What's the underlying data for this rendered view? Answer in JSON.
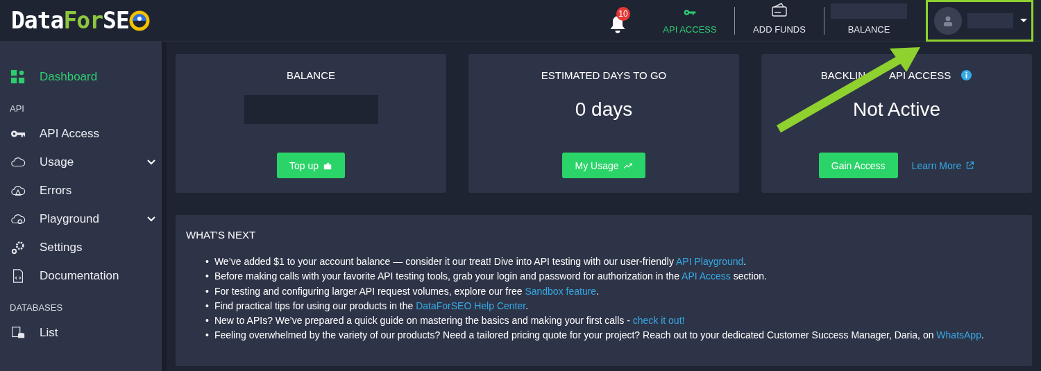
{
  "header": {
    "logo": {
      "parts": [
        "Data",
        "For",
        "SE"
      ]
    },
    "notifications": {
      "count": "10"
    },
    "nav": [
      {
        "kind": "key",
        "label": "API ACCESS",
        "selected": true
      },
      {
        "kind": "card",
        "label": "ADD FUNDS",
        "selected": false
      },
      {
        "kind": "balance",
        "label": "BALANCE",
        "selected": false
      }
    ],
    "user": {
      "kind": "avatar"
    }
  },
  "sidebar": {
    "items": [
      {
        "kind": "item",
        "label": "Dashboard",
        "selected": true,
        "expandable": false
      },
      {
        "kind": "section",
        "label": "API"
      },
      {
        "kind": "item",
        "label": "API Access",
        "selected": false,
        "expandable": false
      },
      {
        "kind": "item",
        "label": "Usage",
        "selected": false,
        "expandable": true
      },
      {
        "kind": "item",
        "label": "Errors",
        "selected": false,
        "expandable": false
      },
      {
        "kind": "item",
        "label": "Playground",
        "selected": false,
        "expandable": true
      },
      {
        "kind": "item",
        "label": "Settings",
        "selected": false,
        "expandable": false
      },
      {
        "kind": "item",
        "label": "Documentation",
        "selected": false,
        "expandable": false
      },
      {
        "kind": "section",
        "label": "DATABASES"
      },
      {
        "kind": "item",
        "label": "List",
        "selected": false,
        "expandable": false
      }
    ]
  },
  "cards": [
    {
      "title": [
        "BALANCE"
      ],
      "kind": "hidden",
      "button": {
        "label": "Top up"
      }
    },
    {
      "title": [
        "ESTIMATED DAYS TO GO"
      ],
      "kind": "value",
      "value": "0 days",
      "button": {
        "label": "My Usage"
      }
    },
    {
      "title": [
        "BACKLIN",
        "API ACCESS"
      ],
      "kind": "value",
      "info": true,
      "value": "Not Active",
      "button": {
        "label": "Gain Access"
      },
      "link": "Learn More"
    }
  ],
  "whats_next": {
    "title": "WHAT'S NEXT",
    "marker": "•",
    "items": [
      [
        {
          "kind": "text",
          "text": "We’ve added $1 to your account balance — consider it our treat! Dive into API testing with our user-friendly "
        },
        {
          "kind": "link",
          "text": "API Playground"
        },
        {
          "kind": "text",
          "text": "."
        }
      ],
      [
        {
          "kind": "text",
          "text": "Before making calls with your favorite API testing tools, grab your login and password for authorization in the "
        },
        {
          "kind": "link",
          "text": "API Access"
        },
        {
          "kind": "text",
          "text": " section."
        }
      ],
      [
        {
          "kind": "text",
          "text": "For testing and configuring larger API request volumes, explore our free "
        },
        {
          "kind": "link",
          "text": "Sandbox feature"
        },
        {
          "kind": "text",
          "text": "."
        }
      ],
      [
        {
          "kind": "text",
          "text": "Find practical tips for using our products in the "
        },
        {
          "kind": "link",
          "text": "DataForSEO Help Center"
        },
        {
          "kind": "text",
          "text": "."
        }
      ],
      [
        {
          "kind": "text",
          "text": "New to APIs? We’ve prepared a quick guide on mastering the basics and making your first calls - "
        },
        {
          "kind": "link",
          "text": "check it out!"
        }
      ],
      [
        {
          "kind": "text",
          "text": "Feeling overwhelmed by the variety of our products? Need a tailored pricing quote for your project? Reach out to your dedicated Customer Success Manager, Daria, on "
        },
        {
          "kind": "link",
          "text": "WhatsApp"
        },
        {
          "kind": "text",
          "text": "."
        }
      ]
    ]
  },
  "annotation": {
    "kind": "arrow-highlight"
  }
}
